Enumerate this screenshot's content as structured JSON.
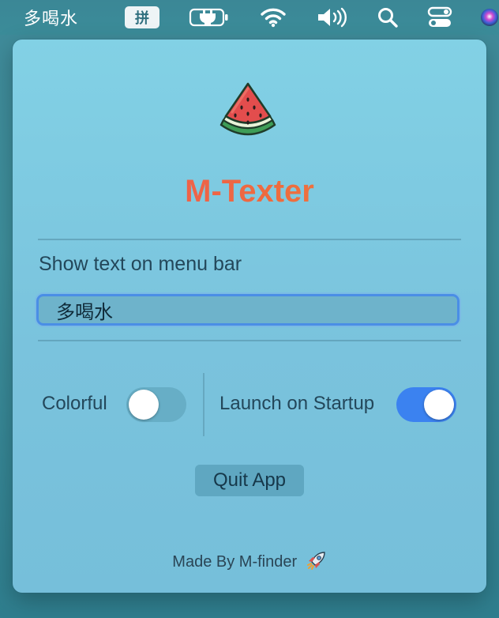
{
  "menubar": {
    "app_text": "多喝水",
    "input_method": "拼",
    "icons": [
      "battery-charging-icon",
      "wifi-icon",
      "volume-icon",
      "search-icon",
      "control-center-icon",
      "siri-icon"
    ]
  },
  "panel": {
    "app_name": "M-Texter",
    "logo_icon": "watermelon-icon",
    "show_text_label": "Show text on menu bar",
    "text_field_value": "多喝水",
    "colorful": {
      "label": "Colorful",
      "on": false
    },
    "launch_on_startup": {
      "label": "Launch on Startup",
      "on": true
    },
    "quit_label": "Quit App",
    "footer_text": "Made By M-finder",
    "footer_icon": "rocket-icon"
  },
  "colors": {
    "accent": "#3b82f0",
    "title_gradient_start": "#f0515e",
    "title_gradient_end": "#f0873b",
    "panel_bg": "#7ac3dd"
  }
}
